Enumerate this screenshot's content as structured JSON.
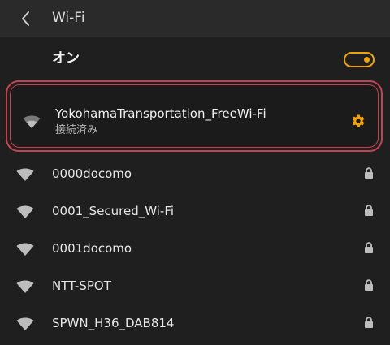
{
  "header": {
    "title": "Wi-Fi"
  },
  "toggle": {
    "label": "オン",
    "state": "on",
    "accent_color": "#f0a20c"
  },
  "connected_network": {
    "ssid": "YokohamaTransportation_FreeWi-Fi",
    "status": "接続済み",
    "highlight_color": "#c44350"
  },
  "networks": [
    {
      "ssid": "0000docomo",
      "locked": true
    },
    {
      "ssid": "0001_Secured_Wi-Fi",
      "locked": true
    },
    {
      "ssid": "0001docomo",
      "locked": true
    },
    {
      "ssid": "NTT-SPOT",
      "locked": true
    },
    {
      "ssid": "SPWN_H36_DAB814",
      "locked": true
    }
  ],
  "icons": {
    "back": "chevron-left-icon",
    "wifi": "wifi-signal-icon",
    "lock": "lock-icon",
    "settings": "gear-icon"
  }
}
